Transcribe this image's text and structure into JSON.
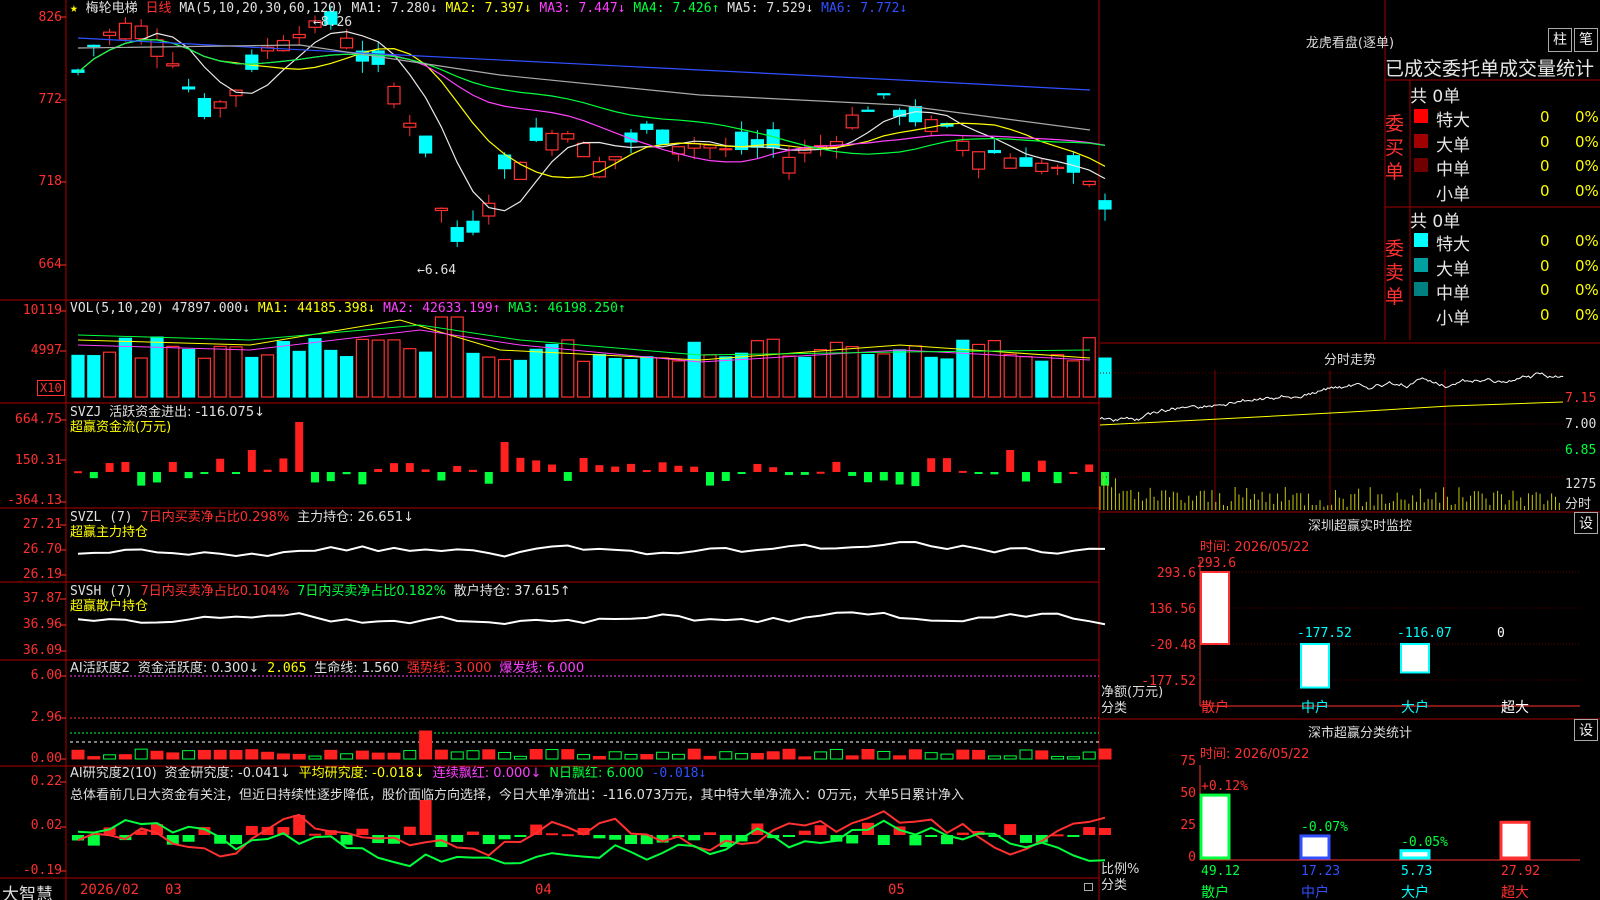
{
  "stock": {
    "star": "★",
    "name": "梅轮电梯",
    "period": "日线"
  },
  "main_header": {
    "ma_label": "MA(5,10,20,30,60,120)",
    "ma1": "MA1: 7.280↓",
    "ma2": "MA2: 7.397↓",
    "ma3": "MA3: 7.447↓",
    "ma4": "MA4: 7.426↑",
    "ma5": "MA5: 7.529↓",
    "ma6": "MA6: 7.772↓"
  },
  "main_axis": [
    "826",
    "772",
    "718",
    "664"
  ],
  "main_annotations": {
    "high": "8.26",
    "low": "6.64"
  },
  "vol_header": {
    "label": "VOL(5,10,20)",
    "v": "47897.000↓",
    "ma1": "MA1: 44185.398↓",
    "ma2": "MA2: 42633.199↑",
    "ma3": "MA3: 46198.250↑"
  },
  "vol_axis": [
    "10119",
    "4997"
  ],
  "vol_unit": "X10",
  "svzj_header": {
    "label": "SVZJ",
    "text": "活跃资金进出: -116.075↓",
    "sub": "超赢资金流(万元)"
  },
  "svzj_axis": [
    "664.75",
    "150.31",
    "-364.13"
  ],
  "svzl_header": {
    "label": "SVZL (7)",
    "ratio": "7日内买卖净占比0.298%",
    "hold": "主力持仓: 26.651↓",
    "sub": "超赢主力持仓"
  },
  "svzl_axis": [
    "27.21",
    "26.70",
    "26.19"
  ],
  "svsh_header": {
    "label": "SVSH (7)",
    "ratio1": "7日内买卖净占比0.104%",
    "ratio2": "7日内买卖净占比0.182%",
    "hold": "散户持仓: 37.615↑",
    "sub": "超赢散户持仓"
  },
  "svsh_axis": [
    "37.87",
    "36.96",
    "36.09"
  ],
  "ai2_header": {
    "label": "AI活跃度2",
    "a": "资金活跃度: 0.300↓",
    "b": "2.065",
    "c": "生命线: 1.560",
    "d": "强势线: 3.000",
    "e": "爆发线: 6.000"
  },
  "ai2_axis": [
    "6.00",
    "2.96",
    "0.00"
  ],
  "ai3_header": {
    "label": "AI研究度2(10)",
    "a": "资金研究度: -0.041↓",
    "b": "平均研究度: -0.018↓",
    "c": "连续飘红: 0.000↓",
    "d": "N日飘红: 6.000",
    "e": "-0.018↓"
  },
  "ai3_text": "总体看前几日大资金有关注，但近日持续性逐步降低，股价面临方向选择，今日大单净流出：-116.073万元，其中特大单净流入：0万元，大单5日累计净入",
  "ai3_axis": [
    "0.22",
    "0.02",
    "-0.19"
  ],
  "bottom": {
    "brand": "大智慧",
    "date": "2026/02",
    "m3": "03",
    "m4": "04",
    "m5": "05"
  },
  "lhb": {
    "title": "龙虎看盘(逐单)",
    "btn1": "柱",
    "btn2": "笔",
    "subtitle": "已成交委托单成交量统计",
    "buy_label": "委买单",
    "sell_label": "委卖单",
    "buy_total": "共 0单",
    "sell_total": "共 0单",
    "buy_rows": [
      {
        "name": "特大",
        "n": "0",
        "p": "0%",
        "color": "#ff0000"
      },
      {
        "name": "大单",
        "n": "0",
        "p": "0%",
        "color": "#a00000"
      },
      {
        "name": "中单",
        "n": "0",
        "p": "0%",
        "color": "#700000"
      },
      {
        "name": "小单",
        "n": "0",
        "p": "0%",
        "color": "#000000"
      }
    ],
    "sell_rows": [
      {
        "name": "特大",
        "n": "0",
        "p": "0%",
        "color": "#00ffff"
      },
      {
        "name": "大单",
        "n": "0",
        "p": "0%",
        "color": "#00a0a0"
      },
      {
        "name": "中单",
        "n": "0",
        "p": "0%",
        "color": "#008080"
      },
      {
        "name": "小单",
        "n": "0",
        "p": "0%",
        "color": "#000000"
      }
    ]
  },
  "intraday": {
    "title": "分时走势",
    "p1": "7.15",
    "p2": "7.00",
    "p3": "6.85",
    "vol": "1275",
    "unit": "分时"
  },
  "sz_monitor": {
    "title": "深圳超赢实时监控",
    "btn": "设",
    "time": "时间: 2026/05/22",
    "axis": [
      "293.6",
      "136.56",
      "-20.48",
      "-177.52"
    ],
    "ylabel1": "净额(万元)",
    "ylabel2": "分类",
    "cats": [
      "散户",
      "中户",
      "大户",
      "超大"
    ],
    "values": [
      293.6,
      -177.52,
      -116.07,
      0
    ],
    "labels": [
      "293.6",
      "-177.52",
      "-116.07",
      "0"
    ]
  },
  "sz_class": {
    "title": "深市超赢分类统计",
    "btn": "设",
    "time": "时间: 2026/05/22",
    "axis": [
      "75",
      "50",
      "25",
      "0"
    ],
    "ylabel1": "比例%",
    "ylabel2": "分类",
    "cats": [
      "散户",
      "中户",
      "大户",
      "超大"
    ],
    "values": [
      49.12,
      17.23,
      5.73,
      27.92
    ],
    "changes": [
      "+0.12%",
      "-0.07%",
      "-0.05%",
      ""
    ],
    "labels": [
      "49.12",
      "17.23",
      "5.73",
      "27.92"
    ]
  }
}
